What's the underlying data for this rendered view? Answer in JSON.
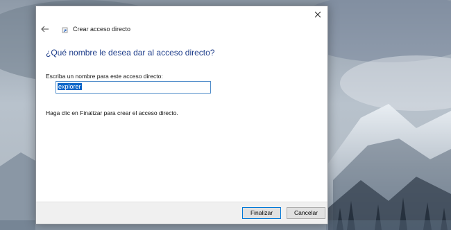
{
  "window": {
    "title": "Crear acceso directo"
  },
  "main": {
    "heading": "¿Qué nombre le desea dar al acceso directo?",
    "field_label": "Escriba un nombre para este acceso directo:",
    "name_value": "explorer",
    "hint": "Haga clic en Finalizar para crear el acceso directo."
  },
  "footer": {
    "finish_label": "Finalizar",
    "cancel_label": "Cancelar"
  },
  "icons": {
    "close": "close-icon",
    "back": "back-arrow-icon",
    "shortcut": "shortcut-icon"
  },
  "colors": {
    "heading": "#1e3d8a",
    "input_border": "#4f8cc9",
    "selection": "#0a64c8",
    "primary_button_border": "#0078d7"
  }
}
